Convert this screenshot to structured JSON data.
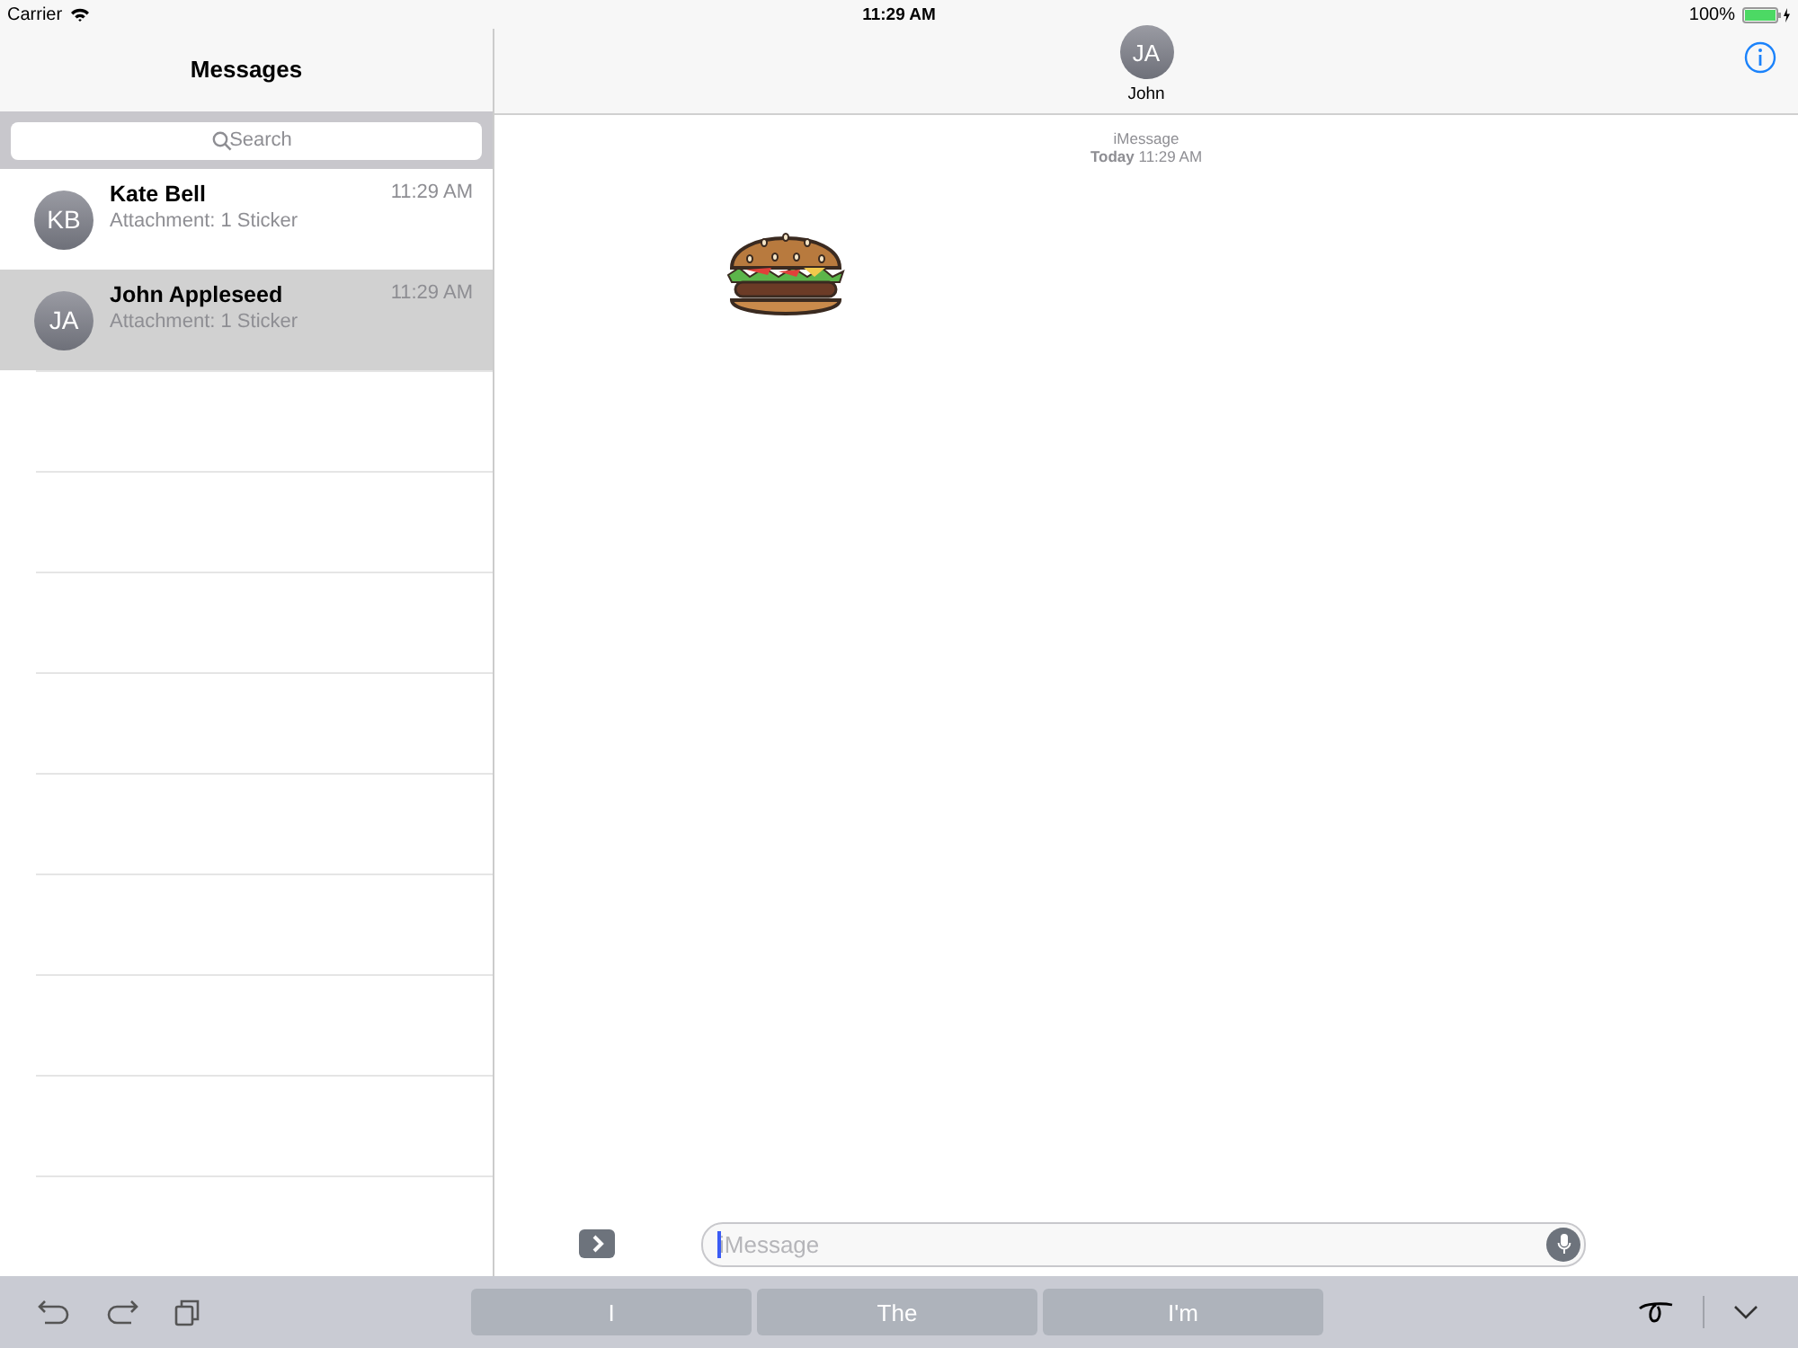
{
  "status_bar": {
    "carrier": "Carrier",
    "time": "11:29 AM",
    "battery": "100%"
  },
  "sidebar": {
    "title": "Messages",
    "search": {
      "placeholder": "Search"
    },
    "conversations": [
      {
        "initials": "KB",
        "name": "Kate Bell",
        "preview": "Attachment: 1 Sticker",
        "time": "11:29 AM",
        "selected": false
      },
      {
        "initials": "JA",
        "name": "John Appleseed",
        "preview": "Attachment: 1 Sticker",
        "time": "11:29 AM",
        "selected": true
      }
    ]
  },
  "conversation": {
    "initials": "JA",
    "name": "John",
    "service": "iMessage",
    "timestamp": "**Today** 11:29 AM"
  },
  "composer": {
    "placeholder": "iMessage"
  },
  "suggestions": [
    {
      "label": "I"
    },
    {
      "label": "The"
    },
    {
      "label": "I'm"
    }
  ]
}
